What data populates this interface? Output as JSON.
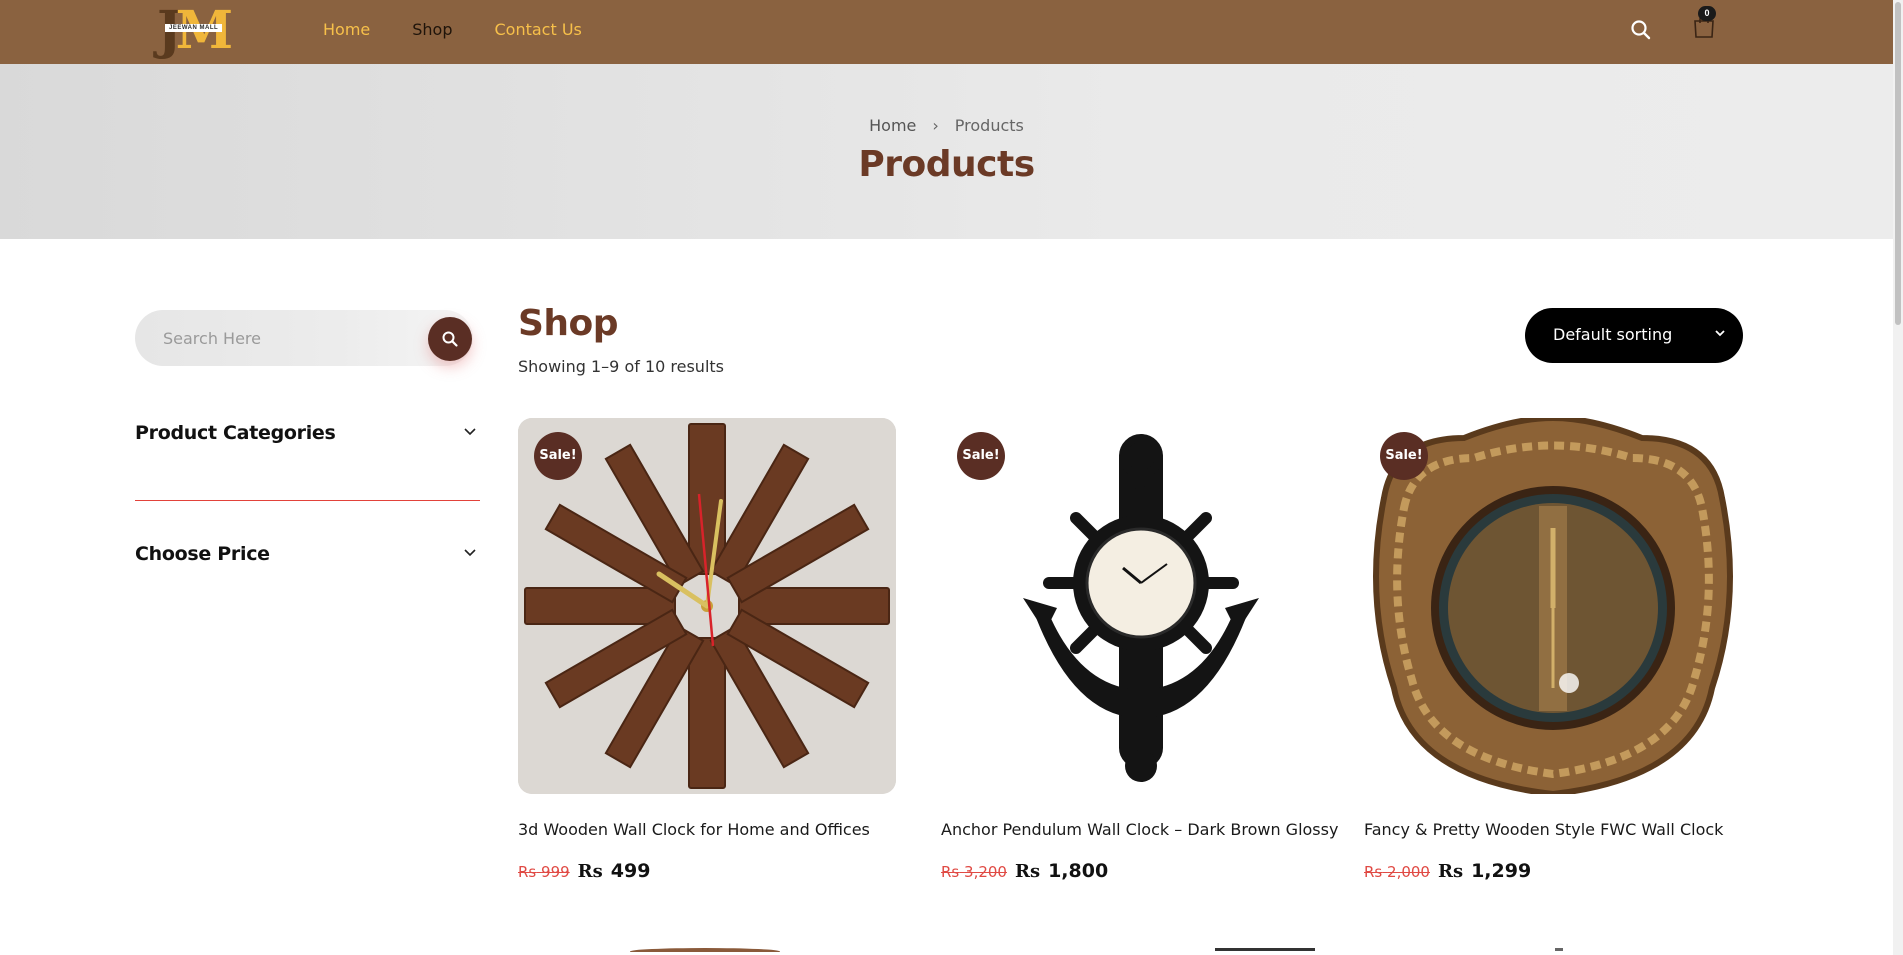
{
  "header": {
    "logo_letters_j": "J",
    "logo_letters_m": "M",
    "logo_tagline": "JEEWAN MALL",
    "nav": [
      {
        "label": "Home"
      },
      {
        "label": "Shop"
      },
      {
        "label": "Contact Us"
      }
    ],
    "cart_count": "0",
    "icons": {
      "search": "search-icon",
      "cart": "shopping-bag-icon"
    }
  },
  "hero": {
    "breadcrumb": {
      "home": "Home",
      "separator": "›",
      "current": "Products"
    },
    "title": "Products"
  },
  "sidebar": {
    "search": {
      "placeholder": "Search Here"
    },
    "sections": [
      {
        "title": "Product Categories"
      },
      {
        "title": "Choose Price"
      }
    ]
  },
  "main": {
    "title": "Shop",
    "result_count": "Showing 1–9 of 10 results",
    "sorting": {
      "selected": "Default sorting"
    },
    "products": [
      {
        "badge": "Sale!",
        "name": "3d Wooden Wall Clock for Home and Offices",
        "currency": "Rs",
        "old_price": "999",
        "price": "499"
      },
      {
        "badge": "Sale!",
        "name": "Anchor Pendulum Wall Clock – Dark Brown Glossy",
        "currency": "Rs",
        "old_price": "3,200",
        "price": "1,800"
      },
      {
        "badge": "Sale!",
        "name": "Fancy & Pretty Wooden Style FWC Wall Clock",
        "currency": "Rs",
        "old_price": "2,000",
        "price": "1,299"
      }
    ]
  },
  "colors": {
    "header_bg": "#8a6240",
    "nav_highlight": "#f7c04a",
    "title_brown": "#6b3a26",
    "badge_bg": "#5a2e24",
    "sale_old_price": "#e04a44",
    "accordion_line": "#e2423a"
  }
}
